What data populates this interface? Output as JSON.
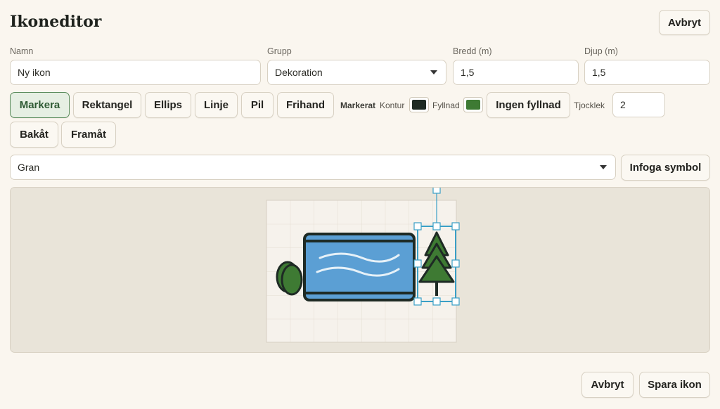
{
  "header": {
    "title": "Ikoneditor",
    "cancel_label": "Avbryt"
  },
  "form": {
    "name_label": "Namn",
    "name_value": "Ny ikon",
    "group_label": "Grupp",
    "group_value": "Dekoration",
    "width_label": "Bredd (m)",
    "width_value": "1,5",
    "depth_label": "Djup (m)",
    "depth_value": "1,5"
  },
  "toolbar": {
    "tools": [
      "Markera",
      "Rektangel",
      "Ellips",
      "Linje",
      "Pil",
      "Frihand"
    ],
    "active_tool": "Markera",
    "selected_label": "Markerat",
    "stroke_label": "Kontur",
    "stroke_color": "#1e2a24",
    "fill_label": "Fyllnad",
    "fill_color": "#3e7a33",
    "no_fill_label": "Ingen fyllnad",
    "thickness_label": "Tjocklek",
    "thickness_value": "2",
    "undo_label": "Bakåt",
    "redo_label": "Framåt"
  },
  "symbol": {
    "selected": "Gran",
    "insert_label": "Infoga symbol"
  },
  "colors": {
    "water": "#5b9fd4",
    "outline": "#1e2a24",
    "tree": "#3e7a33",
    "selection": "#3a9fc6",
    "grid_bg": "#f6f2ec"
  },
  "footer": {
    "cancel_label": "Avbryt",
    "save_label": "Spara ikon"
  }
}
